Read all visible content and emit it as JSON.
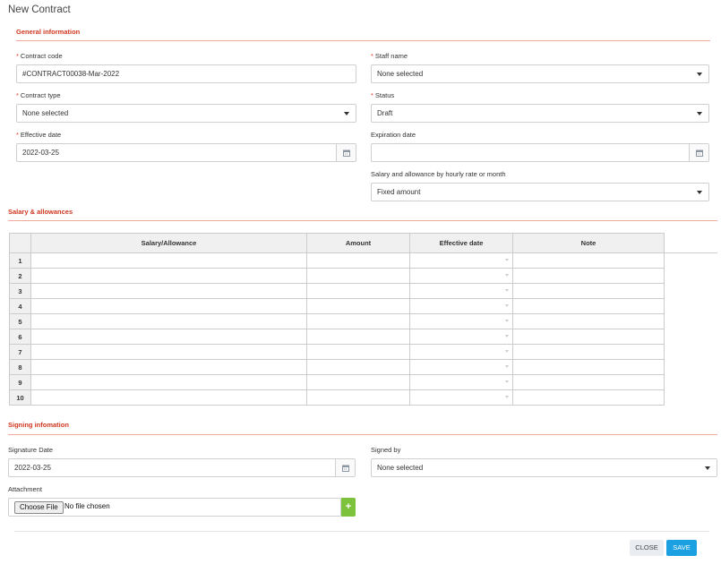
{
  "modal": {
    "title": "New Contract"
  },
  "general": {
    "section_title": "General information",
    "contract_code": {
      "label": "Contract code",
      "value": "#CONTRACT00038-Mar-2022"
    },
    "staff_name": {
      "label": "Staff name",
      "value": "None selected"
    },
    "contract_type": {
      "label": "Contract type",
      "value": "None selected"
    },
    "status": {
      "label": "Status",
      "value": "Draft"
    },
    "effective_date": {
      "label": "Effective date",
      "value": "2022-03-25"
    },
    "expiration_date": {
      "label": "Expiration date",
      "value": ""
    },
    "salary_mode": {
      "label": "Salary and allowance by hourly rate or month",
      "value": "Fixed amount"
    },
    "required_mark": "*"
  },
  "salary": {
    "section_title": "Salary & allowances",
    "columns": [
      "Salary/Allowance",
      "Amount",
      "Effective date",
      "Note"
    ],
    "rows": [
      "1",
      "2",
      "3",
      "4",
      "5",
      "6",
      "7",
      "8",
      "9",
      "10"
    ]
  },
  "signing": {
    "section_title": "Signing infomation",
    "signature_date": {
      "label": "Signature Date",
      "value": "2022-03-25"
    },
    "signed_by": {
      "label": "Signed by",
      "value": "None selected"
    },
    "attachment": {
      "label": "Attachment",
      "button": "Choose File",
      "status": "No file chosen",
      "add_icon": "+"
    }
  },
  "footer": {
    "close_label": "CLOSE",
    "save_label": "SAVE"
  },
  "colors": {
    "accent": "#d0361f",
    "save": "#1ba0e2",
    "add": "#7cc23b"
  }
}
